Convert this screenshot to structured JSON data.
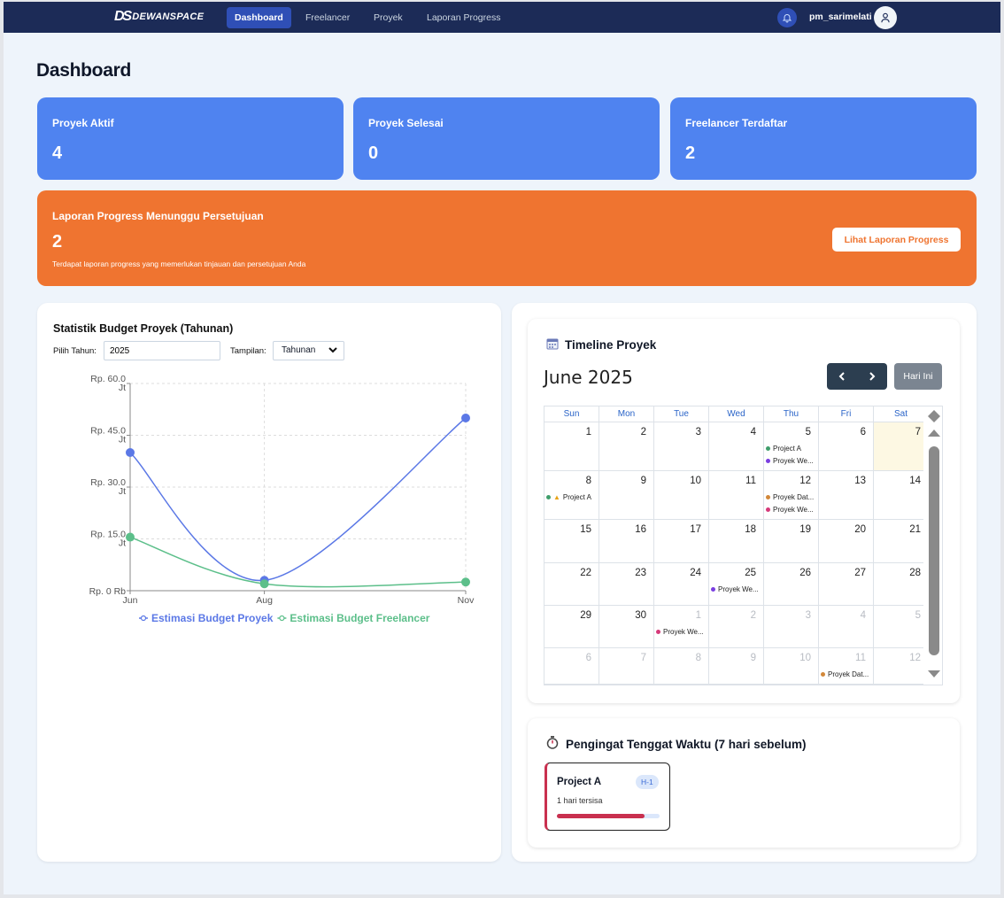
{
  "app": {
    "logo_mark": "DS",
    "logo_text": "DEWANSPACE"
  },
  "nav": {
    "items": [
      {
        "label": "Dashboard",
        "active": true
      },
      {
        "label": "Freelancer",
        "active": false
      },
      {
        "label": "Proyek",
        "active": false
      },
      {
        "label": "Laporan Progress",
        "active": false
      }
    ],
    "username": "pm_sarimelati"
  },
  "page": {
    "title": "Dashboard"
  },
  "stats": [
    {
      "label": "Proyek Aktif",
      "value": "4"
    },
    {
      "label": "Proyek Selesai",
      "value": "0"
    },
    {
      "label": "Freelancer Terdaftar",
      "value": "2"
    }
  ],
  "pending": {
    "title": "Laporan Progress Menunggu Persetujuan",
    "count": "2",
    "description": "Terdapat laporan progress yang memerlukan tinjauan dan persetujuan Anda",
    "button": "Lihat Laporan Progress"
  },
  "budget": {
    "title": "Statistik Budget Proyek (Tahunan)",
    "year_label": "Pilih Tahun:",
    "year_value": "2025",
    "view_label": "Tampilan:",
    "view_value": "Tahunan"
  },
  "chart_data": {
    "type": "line",
    "x": [
      "Jun",
      "Aug",
      "Nov"
    ],
    "ylim": [
      0,
      60
    ],
    "yticks": [
      {
        "value": 0,
        "label": "Rp. 0 Rb"
      },
      {
        "value": 15,
        "label": "Rp. 15.0 Jt"
      },
      {
        "value": 30,
        "label": "Rp. 30.0 Jt"
      },
      {
        "value": 45,
        "label": "Rp. 45.0 Jt"
      },
      {
        "value": 60,
        "label": "Rp. 60.0 Jt"
      }
    ],
    "grid": true,
    "legend": "bottom",
    "series": [
      {
        "name": "Estimasi Budget Proyek",
        "color": "#5b78e6",
        "values": [
          40,
          3,
          50
        ]
      },
      {
        "name": "Estimasi Budget Freelancer",
        "color": "#5cbf8a",
        "values": [
          15.5,
          2,
          2.5
        ]
      }
    ]
  },
  "calendar": {
    "title": "Timeline Proyek",
    "month": "June 2025",
    "prev": "‹",
    "next": "›",
    "today_button": "Hari Ini",
    "weekdays": [
      "Sun",
      "Mon",
      "Tue",
      "Wed",
      "Thu",
      "Fri",
      "Sat"
    ],
    "weeks": [
      [
        {
          "d": "1"
        },
        {
          "d": "2"
        },
        {
          "d": "3"
        },
        {
          "d": "4"
        },
        {
          "d": "5",
          "events": [
            {
              "t": "Project A",
              "c": "#3f9e6b"
            },
            {
              "t": "Proyek We...",
              "c": "#7a3ee0"
            }
          ]
        },
        {
          "d": "6"
        },
        {
          "d": "7",
          "today": true
        }
      ],
      [
        {
          "d": "8",
          "events": [
            {
              "t": "Project A",
              "c": "#3f9e6b",
              "warn": true
            }
          ]
        },
        {
          "d": "9"
        },
        {
          "d": "10"
        },
        {
          "d": "11"
        },
        {
          "d": "12",
          "events": [
            {
              "t": "Proyek Dat...",
              "c": "#d2883a"
            },
            {
              "t": "Proyek We...",
              "c": "#d63a7a"
            }
          ]
        },
        {
          "d": "13"
        },
        {
          "d": "14"
        }
      ],
      [
        {
          "d": "15"
        },
        {
          "d": "16"
        },
        {
          "d": "17"
        },
        {
          "d": "18"
        },
        {
          "d": "19"
        },
        {
          "d": "20"
        },
        {
          "d": "21"
        }
      ],
      [
        {
          "d": "22"
        },
        {
          "d": "23"
        },
        {
          "d": "24"
        },
        {
          "d": "25",
          "events": [
            {
              "t": "Proyek We...",
              "c": "#7a3ee0"
            }
          ]
        },
        {
          "d": "26"
        },
        {
          "d": "27"
        },
        {
          "d": "28"
        }
      ],
      [
        {
          "d": "29"
        },
        {
          "d": "30"
        },
        {
          "d": "1",
          "other": true,
          "events": [
            {
              "t": "Proyek We...",
              "c": "#d63a7a"
            }
          ]
        },
        {
          "d": "2",
          "other": true
        },
        {
          "d": "3",
          "other": true
        },
        {
          "d": "4",
          "other": true
        },
        {
          "d": "5",
          "other": true
        }
      ],
      [
        {
          "d": "6",
          "other": true
        },
        {
          "d": "7",
          "other": true
        },
        {
          "d": "8",
          "other": true
        },
        {
          "d": "9",
          "other": true
        },
        {
          "d": "10",
          "other": true
        },
        {
          "d": "11",
          "other": true,
          "events": [
            {
              "t": "Proyek Dat...",
              "c": "#d2883a"
            }
          ]
        },
        {
          "d": "12",
          "other": true
        }
      ]
    ]
  },
  "reminder": {
    "title": "Pengingat Tenggat Waktu (7 hari sebelum)",
    "items": [
      {
        "name": "Project A",
        "badge": "H-1",
        "remaining": "1 hari tersisa",
        "progress": 0.85,
        "color": "#c9304f"
      }
    ]
  }
}
